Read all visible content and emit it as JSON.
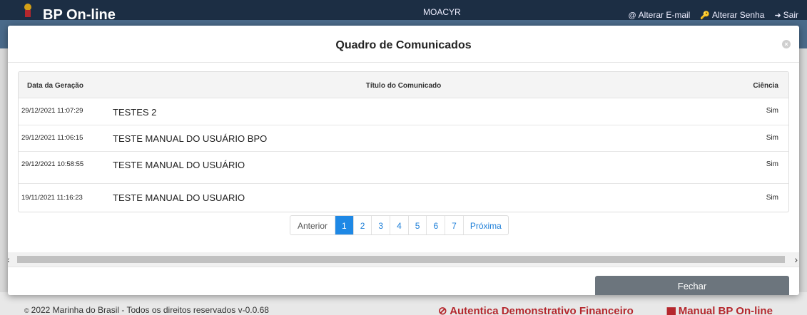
{
  "topbar": {
    "brand": "BP On-line",
    "user": "MOACYR",
    "links": [
      {
        "icon": "at-icon",
        "glyph": "@",
        "label": "Alterar E-mail"
      },
      {
        "icon": "key-icon",
        "glyph": "🔑",
        "label": "Alterar Senha"
      },
      {
        "icon": "sign-out-icon",
        "glyph": "➜",
        "label": "Sair"
      }
    ]
  },
  "modal": {
    "title": "Quadro de Comunicados",
    "table": {
      "headers": {
        "date": "Data da Geração",
        "title": "Título do Comunicado",
        "ciencia": "Ciência"
      },
      "rows": [
        {
          "date": "29/12/2021 11:07:29",
          "title": "TESTES 2",
          "ciencia": "Sim"
        },
        {
          "date": "29/12/2021 11:06:15",
          "title": "TESTE MANUAL DO USUÁRIO BPO",
          "ciencia": "Sim"
        },
        {
          "date": "29/12/2021 10:58:55",
          "title": "TESTE MANUAL DO USUÁRIO",
          "ciencia": "Sim"
        },
        {
          "date": "19/11/2021 11:16:23",
          "title": "TESTE MANUAL DO USUARIO",
          "ciencia": "Sim"
        }
      ]
    },
    "pagination": {
      "prev": "Anterior",
      "pages": [
        "1",
        "2",
        "3",
        "4",
        "5",
        "6",
        "7"
      ],
      "active": "1",
      "next": "Próxima"
    },
    "close_button": "Fechar"
  },
  "footer": {
    "copyright": "2022 Marinha do Brasil - Todos os direitos reservados v-0.0.68",
    "auth_link": "Autentica Demonstrativo Financeiro",
    "manual_link": "Manual BP On-line"
  },
  "colors": {
    "accent": "#1e88e5",
    "topbar": "#1c2e44",
    "footer_link": "#b5272d",
    "button": "#6c757d"
  }
}
